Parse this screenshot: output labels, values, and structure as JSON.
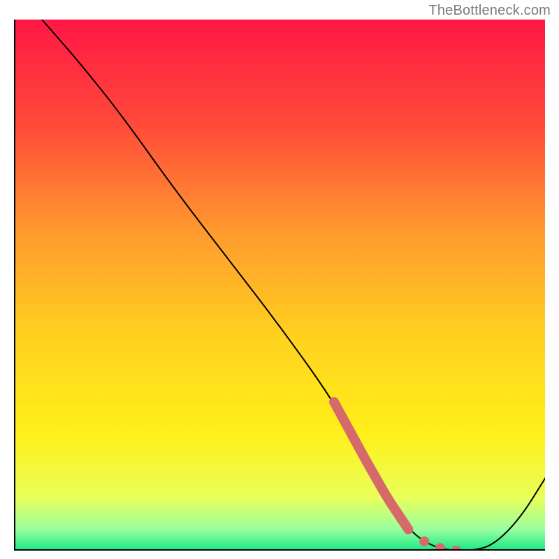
{
  "attribution": "TheBottleneck.com",
  "colors": {
    "gradient_stops": [
      {
        "offset": 0,
        "color": "#ff1745"
      },
      {
        "offset": 20,
        "color": "#ff4b3a"
      },
      {
        "offset": 40,
        "color": "#ff9a2e"
      },
      {
        "offset": 60,
        "color": "#ffd21f"
      },
      {
        "offset": 78,
        "color": "#fff01a"
      },
      {
        "offset": 90,
        "color": "#e9ff5a"
      },
      {
        "offset": 96,
        "color": "#9affa0"
      },
      {
        "offset": 100,
        "color": "#17e884"
      }
    ],
    "curve": "#000000",
    "highlight": "#d66a6a"
  },
  "chart_data": {
    "type": "line",
    "title": "",
    "xlabel": "",
    "ylabel": "",
    "xlim": [
      0,
      100
    ],
    "ylim": [
      0,
      100
    ],
    "grid": false,
    "legend": false,
    "series": [
      {
        "name": "bottleneck_curve",
        "x": [
          5,
          12,
          20,
          30,
          40,
          50,
          60,
          66,
          70,
          74,
          78,
          82,
          86,
          90,
          95,
          100
        ],
        "values": [
          100,
          92,
          82,
          68,
          55,
          42,
          28,
          17,
          10,
          4,
          1,
          0,
          0,
          1,
          6,
          14
        ]
      }
    ],
    "highlight": {
      "segment_x": [
        60,
        74
      ],
      "dots_x": [
        77,
        80,
        83
      ]
    }
  }
}
